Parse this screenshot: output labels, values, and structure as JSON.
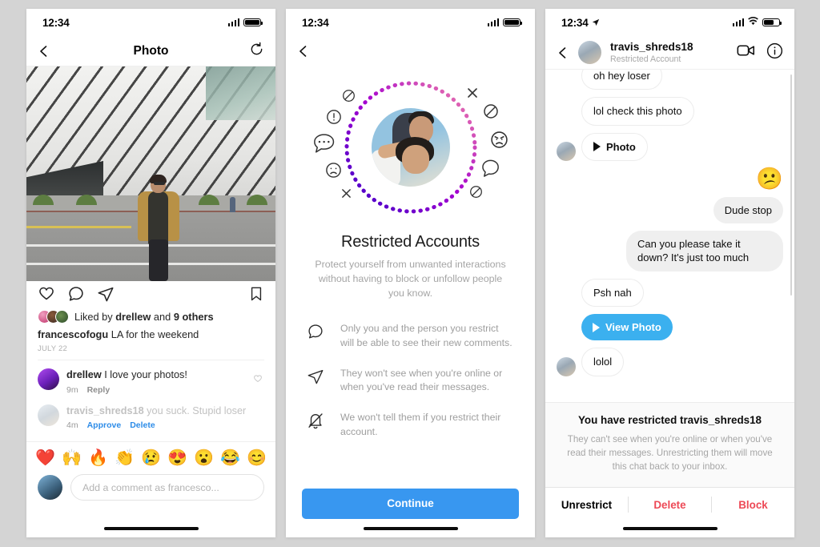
{
  "theme": {
    "bg": "#d4d4d4",
    "accent_blue": "#3897f0",
    "link_blue": "#2d8ce8",
    "bubble_blue": "#3bb0ef",
    "danger_red": "#ed4956",
    "text": "#262626",
    "muted": "#a5a5a5"
  },
  "phone1": {
    "status": {
      "time": "12:34"
    },
    "nav": {
      "title": "Photo",
      "back_icon": "chevron-left-icon",
      "refresh_icon": "rotate-ccw-icon"
    },
    "actions": {
      "like_icon": "heart-icon",
      "comment_icon": "comment-icon",
      "share_icon": "paper-plane-icon",
      "save_icon": "bookmark-icon"
    },
    "likes": {
      "prefix": "Liked by ",
      "user": "drellew",
      "middle": " and ",
      "count": "9 others"
    },
    "caption": {
      "user": "francescofogu",
      "text": " LA for the weekend"
    },
    "date": "JULY 22",
    "comments": [
      {
        "user": "drellew",
        "text": " I love your photos!",
        "time": "9m",
        "action1": "Reply",
        "muted": false,
        "like_icon": "heart-icon"
      },
      {
        "user": "travis_shreds18",
        "text": " you suck. Stupid loser",
        "time": "4m",
        "action1": "Approve",
        "action2": "Delete",
        "muted": true
      }
    ],
    "emoji_row": [
      "❤️",
      "🙌",
      "🔥",
      "👏",
      "😢",
      "😍",
      "😮",
      "😂",
      "😊"
    ],
    "composer": {
      "placeholder": "Add a comment as francesco..."
    }
  },
  "phone2": {
    "status": {
      "time": "12:34"
    },
    "nav": {
      "back_icon": "chevron-left-icon"
    },
    "title": "Restricted Accounts",
    "subtitle": "Protect yourself from unwanted interactions without having to block or unfollow people you know.",
    "features": [
      {
        "icon": "comment-icon",
        "text": "Only you and the person you restrict will be able to see their new comments."
      },
      {
        "icon": "paper-plane-icon",
        "text": "They won't see when you're online or when you've read their messages."
      },
      {
        "icon": "bell-off-icon",
        "text": "We won't tell them if you restrict their account."
      }
    ],
    "cta": "Continue",
    "illustration_icons": [
      "no-entry-icon",
      "exclamation-bubble-icon",
      "ellipsis-bubble-icon",
      "frowning-face-icon",
      "x-icon",
      "x-icon",
      "no-entry-icon",
      "angry-face-icon",
      "speech-bubble-icon",
      "no-entry-icon"
    ]
  },
  "phone3": {
    "status": {
      "time": "12:34",
      "location_icon": "location-arrow-icon"
    },
    "nav": {
      "back_icon": "chevron-left-icon",
      "name": "travis_shreds18",
      "subtitle": "Restricted Account",
      "video_icon": "video-camera-icon",
      "info_icon": "info-circle-icon"
    },
    "messages": [
      {
        "side": "in",
        "type": "text",
        "text": "oh hey loser",
        "avatar": false,
        "clipped": true
      },
      {
        "side": "in",
        "type": "text",
        "text": "lol check this photo",
        "avatar": false
      },
      {
        "side": "in",
        "type": "photo",
        "text": "Photo",
        "avatar": true,
        "icon": "play-icon"
      },
      {
        "side": "out",
        "type": "emoji",
        "text": "😕"
      },
      {
        "side": "out",
        "type": "text",
        "text": "Dude stop"
      },
      {
        "side": "out",
        "type": "text",
        "text": "Can you please take it down? It's just too much"
      },
      {
        "side": "in",
        "type": "text",
        "text": "Psh nah",
        "avatar": false
      },
      {
        "side": "in",
        "type": "cta",
        "text": "View Photo",
        "avatar": false,
        "icon": "play-icon"
      },
      {
        "side": "in",
        "type": "text",
        "text": "lolol",
        "avatar": true
      }
    ],
    "restricted_note": {
      "title": "You have restricted travis_shreds18",
      "body": "They can't see when you're online or when you've read their messages. Unrestricting them will move this chat back to your inbox."
    },
    "actions": [
      {
        "label": "Unrestrict",
        "style": "normal"
      },
      {
        "label": "Delete",
        "style": "danger"
      },
      {
        "label": "Block",
        "style": "danger"
      }
    ]
  }
}
